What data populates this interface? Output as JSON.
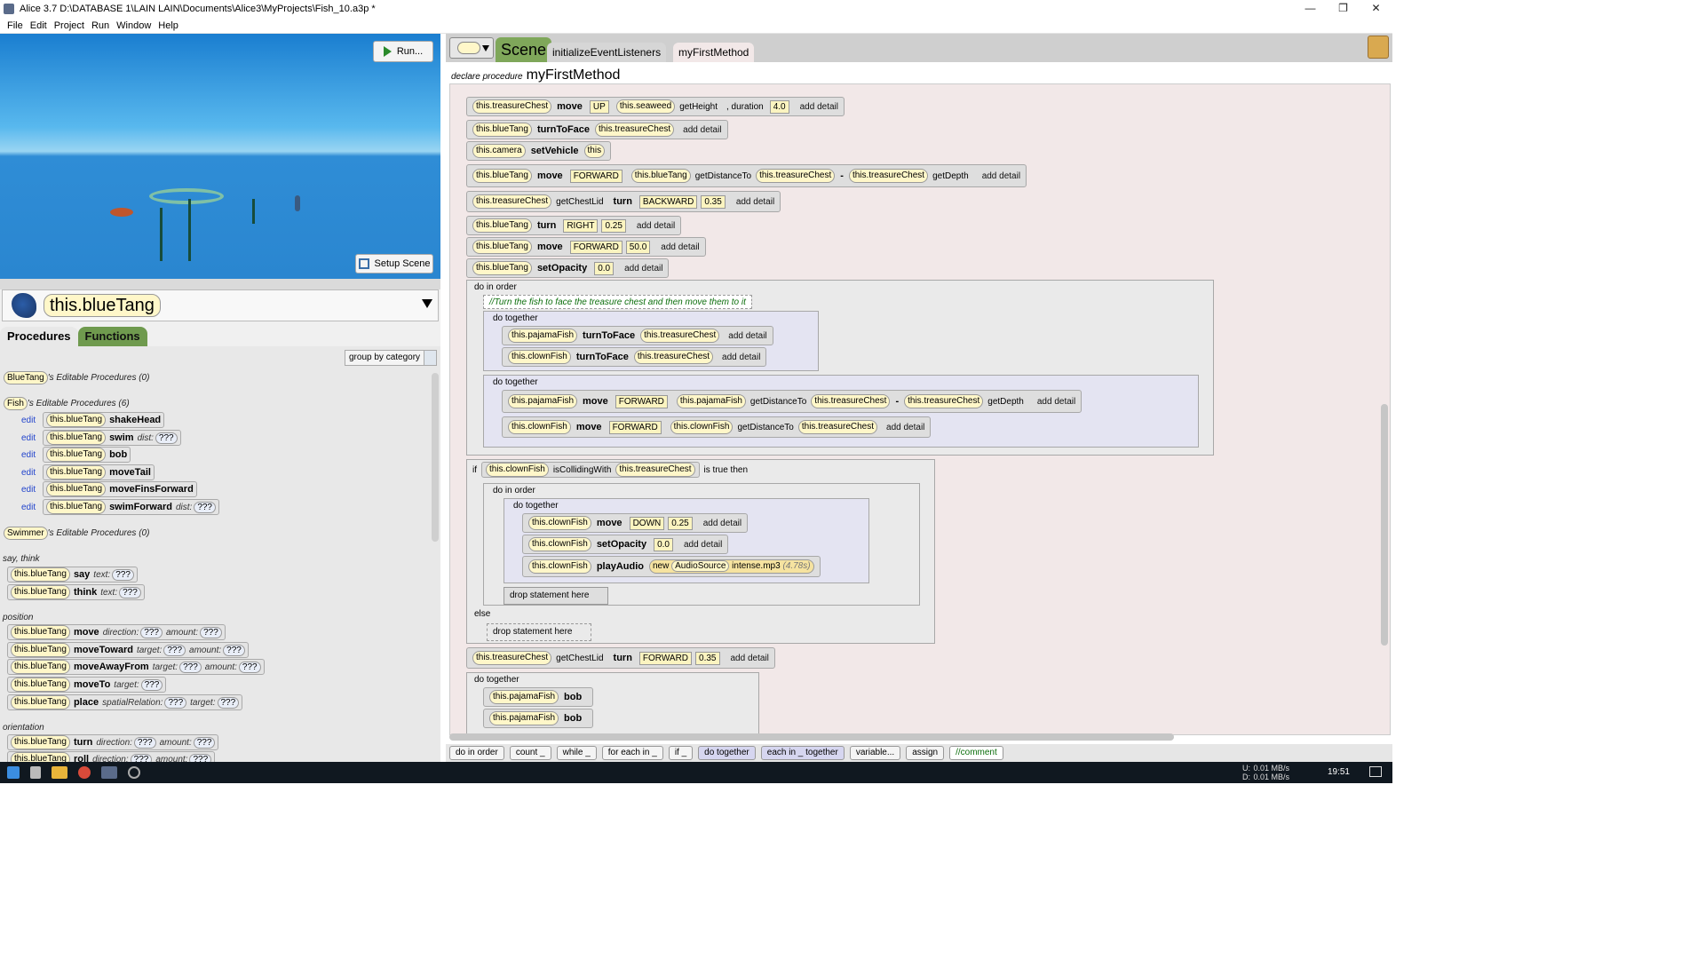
{
  "window": {
    "title": "Alice 3.7 D:\\DATABASE 1\\LAIN LAIN\\Documents\\Alice3\\MyProjects\\Fish_10.a3p *",
    "controls": [
      "—",
      "❐",
      "✕"
    ]
  },
  "menu": [
    "File",
    "Edit",
    "Project",
    "Run",
    "Window",
    "Help"
  ],
  "scene_view": {
    "run_label": "Run...",
    "setup_label": "Setup Scene"
  },
  "selector": {
    "selected": "this.blueTang"
  },
  "left_tabs": [
    "Procedures",
    "Functions"
  ],
  "group_by": "group by category",
  "left_list": {
    "bluetang_class": "BlueTang",
    "bluetang_header": "'s Editable Procedures (0)",
    "fish_class": "Fish",
    "fish_header": "'s Editable Procedures (6)",
    "edit_label": "edit",
    "fish_procs": [
      {
        "target": "this.blueTang",
        "name": "shakeHead",
        "param": "",
        "val": ""
      },
      {
        "target": "this.blueTang",
        "name": "swim",
        "param": "dist:",
        "val": "???"
      },
      {
        "target": "this.blueTang",
        "name": "bob",
        "param": "",
        "val": ""
      },
      {
        "target": "this.blueTang",
        "name": "moveTail",
        "param": "",
        "val": ""
      },
      {
        "target": "this.blueTang",
        "name": "moveFinsForward",
        "param": "",
        "val": ""
      },
      {
        "target": "this.blueTang",
        "name": "swimForward",
        "param": "dist:",
        "val": "???"
      }
    ],
    "swimmer_class": "Swimmer",
    "swimmer_header": "'s Editable Procedures (0)",
    "cat_say": "say, think",
    "say": [
      {
        "target": "this.blueTang",
        "name": "say",
        "p1": "text:",
        "v1": "???"
      },
      {
        "target": "this.blueTang",
        "name": "think",
        "p1": "text:",
        "v1": "???"
      }
    ],
    "cat_position": "position",
    "position": [
      {
        "target": "this.blueTang",
        "name": "move",
        "p1": "direction:",
        "v1": "???",
        "p2": "amount:",
        "v2": "???"
      },
      {
        "target": "this.blueTang",
        "name": "moveToward",
        "p1": "target:",
        "v1": "???",
        "p2": "amount:",
        "v2": "???"
      },
      {
        "target": "this.blueTang",
        "name": "moveAwayFrom",
        "p1": "target:",
        "v1": "???",
        "p2": "amount:",
        "v2": "???"
      },
      {
        "target": "this.blueTang",
        "name": "moveTo",
        "p1": "target:",
        "v1": "???",
        "p2": "",
        "v2": ""
      },
      {
        "target": "this.blueTang",
        "name": "place",
        "p1": "spatialRelation:",
        "v1": "???",
        "p2": "target:",
        "v2": "???"
      }
    ],
    "cat_orientation": "orientation",
    "orientation": [
      {
        "target": "this.blueTang",
        "name": "turn",
        "p1": "direction:",
        "v1": "???",
        "p2": "amount:",
        "v2": "???"
      },
      {
        "target": "this.blueTang",
        "name": "roll",
        "p1": "direction:",
        "v1": "???",
        "p2": "amount:",
        "v2": "???"
      }
    ]
  },
  "code_tabs": {
    "scene": "Scene",
    "tab1": "initializeEventListeners",
    "tab2": "myFirstMethod"
  },
  "declare": {
    "prefix": "declare procedure",
    "name": "myFirstMethod"
  },
  "code": {
    "s1": {
      "t": "this.treasureChest",
      "m": "move",
      "a1": "UP",
      "f": "this.seaweed",
      "fm": "getHeight",
      "k": ", duration",
      "v": "4.0"
    },
    "s2": {
      "t": "this.blueTang",
      "m": "turnToFace",
      "a1": "this.treasureChest"
    },
    "s3": {
      "t": "this.camera",
      "m": "setVehicle",
      "a1": "this"
    },
    "s4": {
      "t": "this.blueTang",
      "m": "move",
      "a1": "FORWARD",
      "f": "this.blueTang",
      "fm": "getDistanceTo",
      "fa": "this.treasureChest",
      "op": "-",
      "g": "this.treasureChest",
      "gm": "getDepth"
    },
    "s5": {
      "t": "this.treasureChest",
      "fm": "getChestLid",
      "m": "turn",
      "a1": "BACKWARD",
      "v": "0.35"
    },
    "s6": {
      "t": "this.blueTang",
      "m": "turn",
      "a1": "RIGHT",
      "v": "0.25"
    },
    "s7": {
      "t": "this.blueTang",
      "m": "move",
      "a1": "FORWARD",
      "v": "50.0"
    },
    "s8": {
      "t": "this.blueTang",
      "m": "setOpacity",
      "v": "0.0"
    },
    "do_in_order": "do in order",
    "comment": "//Turn the fish to face the treasure chest and then move them to it",
    "do_together": "do together",
    "dt1_a": {
      "t": "this.pajamaFish",
      "m": "turnToFace",
      "a1": "this.treasureChest"
    },
    "dt1_b": {
      "t": "this.clownFish",
      "m": "turnToFace",
      "a1": "this.treasureChest"
    },
    "dt2_a": {
      "t": "this.pajamaFish",
      "m": "move",
      "a1": "FORWARD",
      "f": "this.pajamaFish",
      "fm": "getDistanceTo",
      "fa": "this.treasureChest",
      "op": "-",
      "g": "this.treasureChest",
      "gm": "getDepth"
    },
    "dt2_b": {
      "t": "this.clownFish",
      "m": "move",
      "a1": "FORWARD",
      "f": "this.clownFish",
      "fm": "getDistanceTo",
      "fa": "this.treasureChest"
    },
    "if_kw": "if",
    "if_cond": {
      "t": "this.clownFish",
      "m": "isCollidingWith",
      "a1": "this.treasureChest"
    },
    "if_tail": "is true then",
    "i1": {
      "t": "this.clownFish",
      "m": "move",
      "a1": "DOWN",
      "v": "0.25"
    },
    "i2": {
      "t": "this.clownFish",
      "m": "setOpacity",
      "v": "0.0"
    },
    "i3": {
      "t": "this.clownFish",
      "m": "playAudio",
      "new": "new",
      "cls": "AudioSource",
      "file": "intense.mp3",
      "dur": "(4.78s)"
    },
    "drop": "drop statement here",
    "else_kw": "else",
    "s9": {
      "t": "this.treasureChest",
      "fm": "getChestLid",
      "m": "turn",
      "a1": "FORWARD",
      "v": "0.35"
    },
    "dt3_a": {
      "t": "this.pajamaFish",
      "m": "bob"
    },
    "dt3_b": {
      "t": "this.pajamaFish",
      "m": "bob"
    },
    "add_detail": "add detail"
  },
  "bottom_controls": [
    "do in order",
    "count _",
    "while _",
    "for each in _",
    "if _",
    "do together",
    "each in _ together",
    "variable...",
    "assign",
    "//comment"
  ],
  "taskbar": {
    "tray_up": "U:",
    "tray_down": "D:",
    "up_rate": "0.01 MB/s",
    "down_rate": "0.01 MB/s",
    "time": "19:51"
  }
}
